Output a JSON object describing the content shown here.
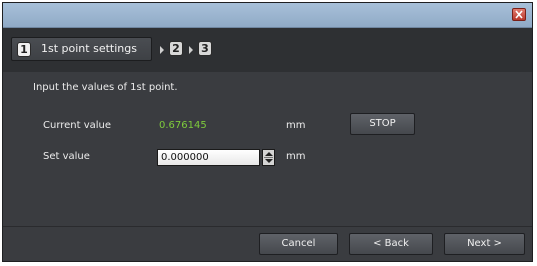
{
  "window": {
    "title": ""
  },
  "steps": {
    "step1": {
      "number": "1",
      "label": "1st point settings"
    },
    "step2": {
      "number": "2"
    },
    "step3": {
      "number": "3"
    }
  },
  "instruction": "Input the values of 1st point.",
  "current_value": {
    "label": "Current value",
    "value": "0.676145",
    "unit": "mm",
    "value_color": "#7ecb3c"
  },
  "set_value": {
    "label": "Set value",
    "value": "0.000000",
    "unit": "mm"
  },
  "buttons": {
    "stop": "STOP",
    "cancel": "Cancel",
    "back": "< Back",
    "next": "Next >"
  },
  "icons": {
    "close": "close-icon",
    "arrow": "chevron-right-icon",
    "spin": "spin-updown-icon"
  }
}
